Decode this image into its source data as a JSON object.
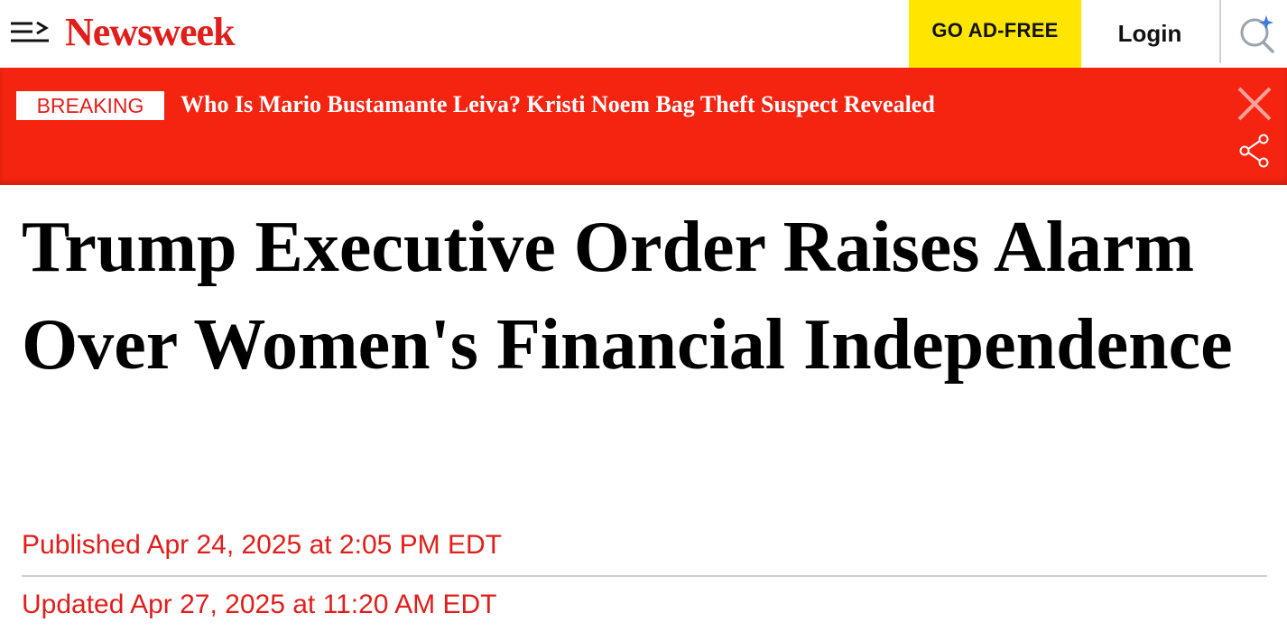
{
  "header": {
    "logo_text": "Newsweek",
    "ad_free_label": "GO AD-FREE",
    "login_label": "Login",
    "menu_icon": "menu-arrow-icon",
    "search_icon": "search-sparkle-icon"
  },
  "breaking": {
    "tag": "BREAKING",
    "headline": "Who Is Mario Bustamante Leiva? Kristi Noem Bag Theft Suspect Revealed",
    "close_icon": "close-icon",
    "share_icon": "share-icon"
  },
  "article": {
    "title": "Trump Executive Order Raises Alarm Over Women's Financial Independence",
    "published": "Published Apr 24, 2025 at 2:05 PM EDT",
    "updated": "Updated Apr 27, 2025 at 11:20 AM EDT"
  },
  "colors": {
    "brand_red": "#e01e1b",
    "banner_red": "#f52411",
    "ad_free_yellow": "#ffe500"
  }
}
